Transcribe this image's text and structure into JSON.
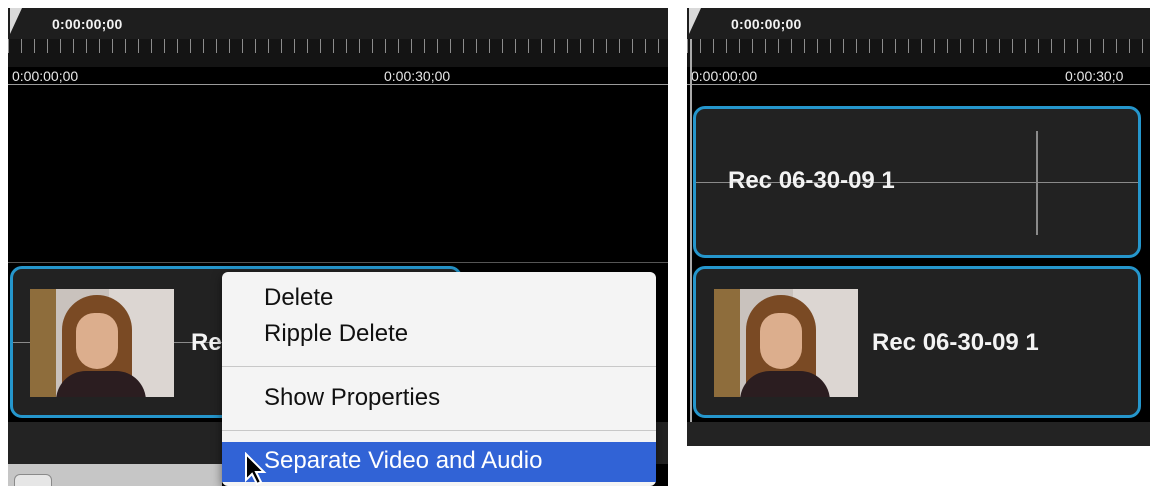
{
  "left": {
    "playhead_timecode": "0:00:00;00",
    "ruler_labels": [
      "0:00:00;00",
      "0:00:30;00"
    ],
    "clip_label": "Rec 0"
  },
  "context_menu": {
    "items": [
      "Delete",
      "Ripple Delete",
      "Show Properties",
      "Separate Video and Audio"
    ],
    "highlighted_index": 3
  },
  "right": {
    "playhead_timecode": "0:00:00;00",
    "ruler_labels": [
      "0:00:00;00",
      "0:00:30;0"
    ],
    "audio_clip_label": "Rec 06-30-09 1",
    "video_clip_label": "Rec 06-30-09 1"
  },
  "colors": {
    "clip_border": "#2596cc",
    "menu_highlight": "#3163d6"
  },
  "icons": {
    "playhead": "playhead-marker-icon",
    "cursor": "mouse-pointer-icon",
    "zoom": "zoom-magnifier-icon"
  }
}
